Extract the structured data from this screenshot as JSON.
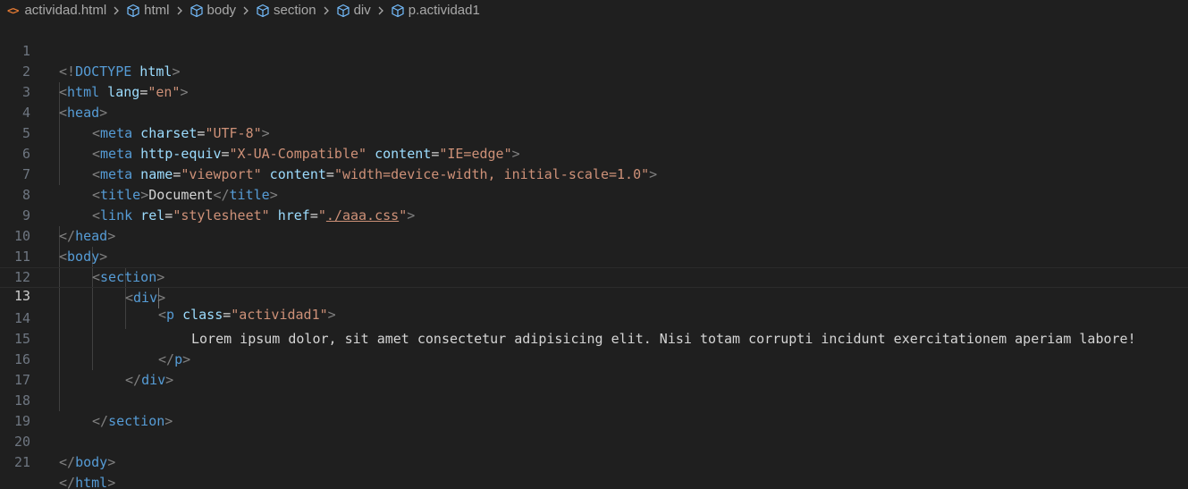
{
  "breadcrumb": {
    "file_icon": "html-file-icon",
    "file": "actividad.html",
    "items": [
      "html",
      "body",
      "section",
      "div",
      "p.actividad1"
    ],
    "item_icon": "cube-icon",
    "separator_icon": "chevron-right-icon"
  },
  "editor": {
    "current_line": 13,
    "line_numbers": [
      "1",
      "2",
      "3",
      "4",
      "5",
      "6",
      "7",
      "8",
      "9",
      "10",
      "11",
      "12",
      "13",
      "14",
      "15",
      "16",
      "17",
      "18",
      "19",
      "20",
      "21"
    ],
    "tokens": {
      "doctype_open": "<!",
      "doctype_kw": "DOCTYPE",
      "doctype_html": " html",
      "lt": "<",
      "gt": ">",
      "lt_slash": "</",
      "eq": "=",
      "tag_html": "html",
      "tag_head": "head",
      "tag_meta": "meta",
      "tag_title": "title",
      "tag_link": "link",
      "tag_body": "body",
      "tag_section": "section",
      "tag_div": "div",
      "tag_p": "p",
      "attr_lang": " lang",
      "attr_charset": " charset",
      "attr_http_equiv": " http-equiv",
      "attr_content": " content",
      "attr_name": " name",
      "attr_rel": " rel",
      "attr_href": " href",
      "attr_class": " class",
      "str_en": "\"en\"",
      "str_utf8": "\"UTF-8\"",
      "str_xua": "\"X-UA-Compatible\"",
      "str_ie": "\"IE=edge\"",
      "str_viewport": "\"viewport\"",
      "str_width": "\"width=device-width, initial-scale=1.0\"",
      "str_stylesheet": "\"stylesheet\"",
      "quote": "\"",
      "href_value": "./aaa.css",
      "str_actividad": "\"actividad1\"",
      "title_text": "Document",
      "lorem": "Lorem ipsum dolor, sit amet consectetur adipisicing elit. Nisi totam corrupti incidunt exercitationem aperiam labore!"
    }
  }
}
